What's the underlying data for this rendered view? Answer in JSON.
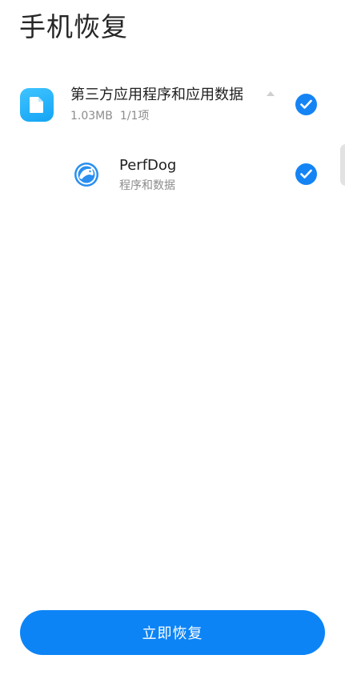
{
  "page": {
    "title": "手机恢复"
  },
  "group": {
    "title": "第三方应用程序和应用数据",
    "size": "1.03MB",
    "count": "1/1项",
    "checked": true,
    "icon": "document-icon"
  },
  "apps": [
    {
      "name": "PerfDog",
      "subtitle": "程序和数据",
      "checked": true,
      "icon": "perfdog-icon"
    }
  ],
  "actions": {
    "restore_label": "立即恢复"
  },
  "colors": {
    "accent": "#0c84f6",
    "check": "#1484f5",
    "file_icon": "#26b2fb"
  }
}
